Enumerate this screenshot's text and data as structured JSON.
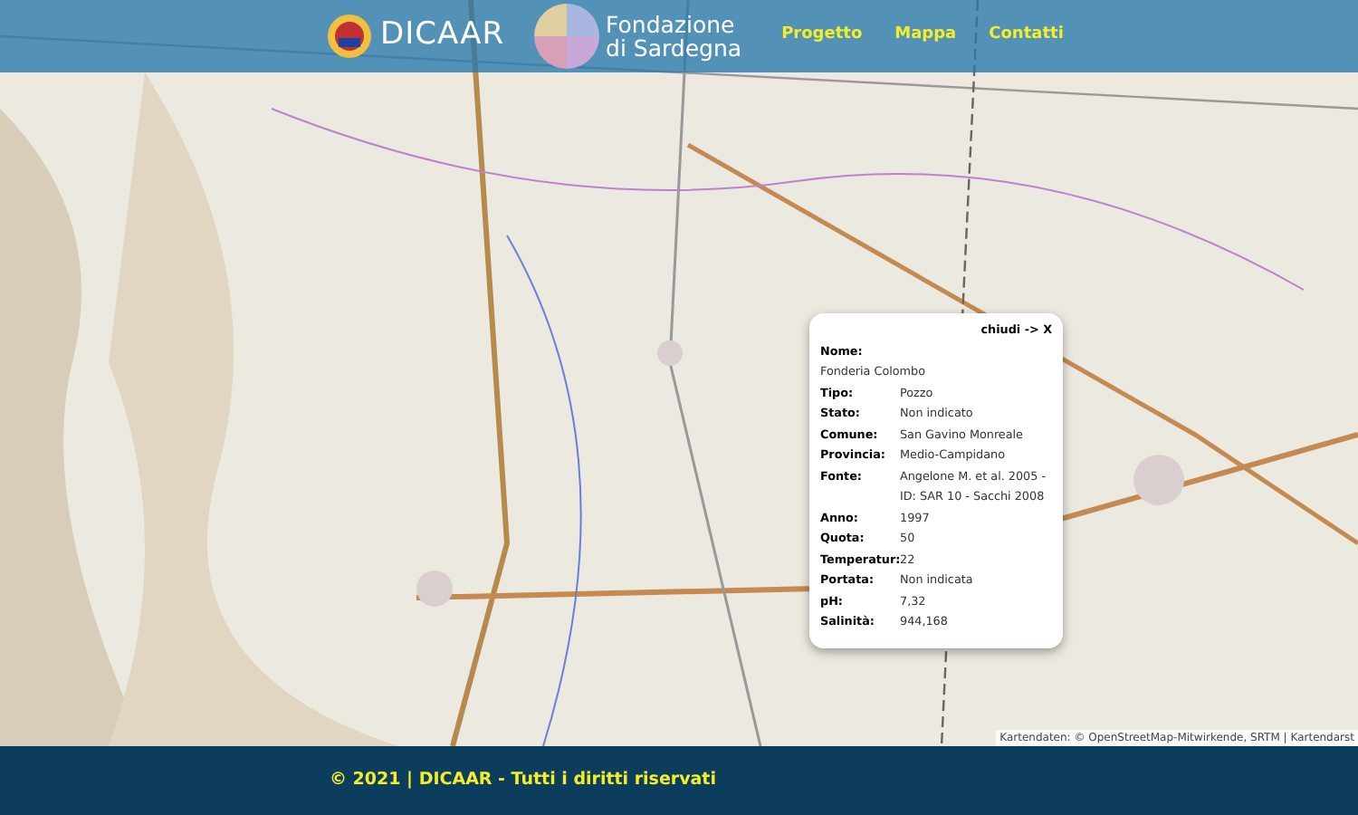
{
  "header": {
    "logo_text": "DICAAR",
    "partner_lines": [
      "Fondazione",
      "di Sardegna"
    ],
    "nav": [
      {
        "label": "Progetto"
      },
      {
        "label": "Mappa"
      },
      {
        "label": "Contatti"
      }
    ]
  },
  "popup": {
    "close": "chiudi -> X",
    "fields": [
      {
        "label": "Nome:",
        "value": "Fonderia Colombo",
        "kind": "stacked"
      },
      {
        "label": "Tipo:",
        "value": "Pozzo",
        "kind": "inline"
      },
      {
        "label": "Stato:",
        "value": "Non indicato",
        "kind": "inline"
      },
      {
        "label": "Comune:",
        "value": "San Gavino Monreale",
        "kind": "inline"
      },
      {
        "label": "Provincia:",
        "value": "Medio-Campidano",
        "kind": "inline"
      },
      {
        "label": "Fonte:",
        "value": "Angelone M. et al. 2005 - ID: SAR 10 - Sacchi 2008",
        "kind": "inline"
      },
      {
        "label": "Anno:",
        "value": "1997",
        "kind": "inline"
      },
      {
        "label": "Quota:",
        "value": "50",
        "kind": "inline"
      },
      {
        "label": "Temperatur:",
        "value": "22",
        "kind": "inline"
      },
      {
        "label": "Portata:",
        "value": "Non indicata",
        "kind": "inline"
      },
      {
        "label": "pH:",
        "value": "7,32",
        "kind": "inline"
      },
      {
        "label": "Salinità:",
        "value": "944,168",
        "kind": "inline"
      }
    ]
  },
  "attribution": "Kartendaten: © OpenStreetMap-Mitwirkende, SRTM | Kartendarst",
  "footer": {
    "text": "© 2021 | DICAAR - Tutti i diritti riservati"
  }
}
